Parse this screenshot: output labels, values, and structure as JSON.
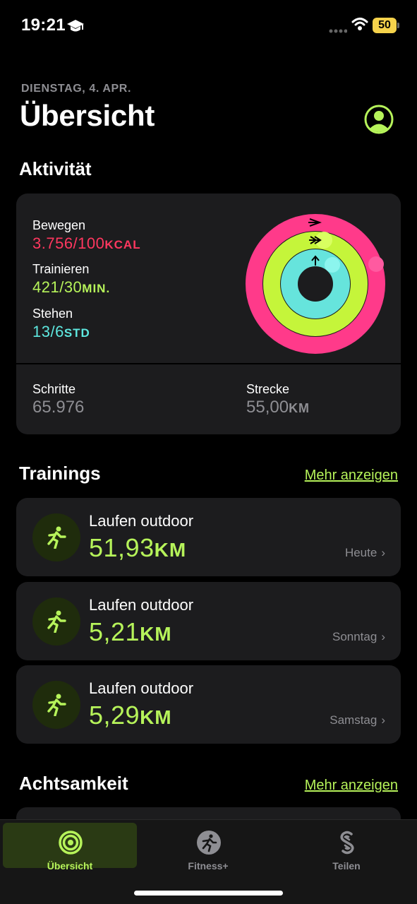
{
  "status": {
    "time": "19:21",
    "battery": "50"
  },
  "header": {
    "date": "DIENSTAG, 4. APR.",
    "title": "Übersicht"
  },
  "activity": {
    "heading": "Aktivität",
    "move": {
      "label": "Bewegen",
      "value": "3.756/100",
      "unit": "KCAL",
      "color": "#ff375f"
    },
    "exercise": {
      "label": "Trainieren",
      "value": "421/30",
      "unit": "MIN.",
      "color": "#b6f35a"
    },
    "stand": {
      "label": "Stehen",
      "value": "13/6",
      "unit": "STD",
      "color": "#5ee8e0"
    },
    "steps": {
      "label": "Schritte",
      "value": "65.976"
    },
    "distance": {
      "label": "Strecke",
      "value": "55,00",
      "unit": "KM"
    }
  },
  "trainings": {
    "heading": "Trainings",
    "more": "Mehr anzeigen",
    "items": [
      {
        "name": "Laufen outdoor",
        "value": "51,93",
        "unit": "KM",
        "day": "Heute"
      },
      {
        "name": "Laufen outdoor",
        "value": "5,21",
        "unit": "KM",
        "day": "Sonntag"
      },
      {
        "name": "Laufen outdoor",
        "value": "5,29",
        "unit": "KM",
        "day": "Samstag"
      }
    ]
  },
  "mindfulness": {
    "heading": "Achtsamkeit",
    "more": "Mehr anzeigen"
  },
  "tabbar": {
    "tabs": [
      {
        "label": "Übersicht",
        "active": true
      },
      {
        "label": "Fitness+",
        "active": false
      },
      {
        "label": "Teilen",
        "active": false
      }
    ]
  }
}
